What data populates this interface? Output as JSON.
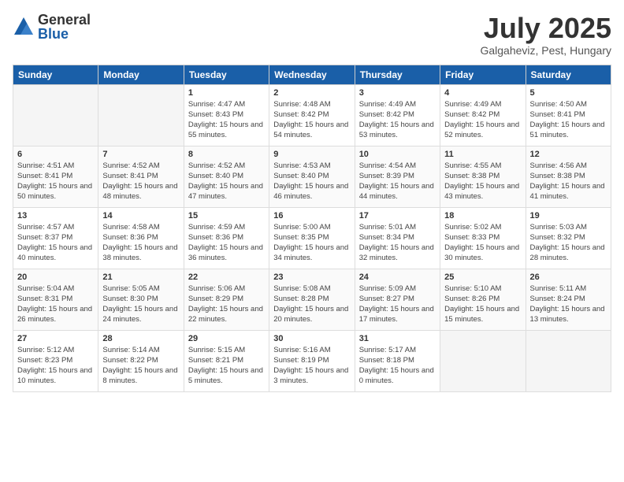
{
  "logo": {
    "general": "General",
    "blue": "Blue"
  },
  "header": {
    "month": "July 2025",
    "location": "Galgaheviz, Pest, Hungary"
  },
  "weekdays": [
    "Sunday",
    "Monday",
    "Tuesday",
    "Wednesday",
    "Thursday",
    "Friday",
    "Saturday"
  ],
  "weeks": [
    [
      {
        "day": "",
        "empty": true
      },
      {
        "day": "",
        "empty": true
      },
      {
        "day": "1",
        "sunrise": "4:47 AM",
        "sunset": "8:43 PM",
        "daylight": "15 hours and 55 minutes."
      },
      {
        "day": "2",
        "sunrise": "4:48 AM",
        "sunset": "8:42 PM",
        "daylight": "15 hours and 54 minutes."
      },
      {
        "day": "3",
        "sunrise": "4:49 AM",
        "sunset": "8:42 PM",
        "daylight": "15 hours and 53 minutes."
      },
      {
        "day": "4",
        "sunrise": "4:49 AM",
        "sunset": "8:42 PM",
        "daylight": "15 hours and 52 minutes."
      },
      {
        "day": "5",
        "sunrise": "4:50 AM",
        "sunset": "8:41 PM",
        "daylight": "15 hours and 51 minutes."
      }
    ],
    [
      {
        "day": "6",
        "sunrise": "4:51 AM",
        "sunset": "8:41 PM",
        "daylight": "15 hours and 50 minutes."
      },
      {
        "day": "7",
        "sunrise": "4:52 AM",
        "sunset": "8:41 PM",
        "daylight": "15 hours and 48 minutes."
      },
      {
        "day": "8",
        "sunrise": "4:52 AM",
        "sunset": "8:40 PM",
        "daylight": "15 hours and 47 minutes."
      },
      {
        "day": "9",
        "sunrise": "4:53 AM",
        "sunset": "8:40 PM",
        "daylight": "15 hours and 46 minutes."
      },
      {
        "day": "10",
        "sunrise": "4:54 AM",
        "sunset": "8:39 PM",
        "daylight": "15 hours and 44 minutes."
      },
      {
        "day": "11",
        "sunrise": "4:55 AM",
        "sunset": "8:38 PM",
        "daylight": "15 hours and 43 minutes."
      },
      {
        "day": "12",
        "sunrise": "4:56 AM",
        "sunset": "8:38 PM",
        "daylight": "15 hours and 41 minutes."
      }
    ],
    [
      {
        "day": "13",
        "sunrise": "4:57 AM",
        "sunset": "8:37 PM",
        "daylight": "15 hours and 40 minutes."
      },
      {
        "day": "14",
        "sunrise": "4:58 AM",
        "sunset": "8:36 PM",
        "daylight": "15 hours and 38 minutes."
      },
      {
        "day": "15",
        "sunrise": "4:59 AM",
        "sunset": "8:36 PM",
        "daylight": "15 hours and 36 minutes."
      },
      {
        "day": "16",
        "sunrise": "5:00 AM",
        "sunset": "8:35 PM",
        "daylight": "15 hours and 34 minutes."
      },
      {
        "day": "17",
        "sunrise": "5:01 AM",
        "sunset": "8:34 PM",
        "daylight": "15 hours and 32 minutes."
      },
      {
        "day": "18",
        "sunrise": "5:02 AM",
        "sunset": "8:33 PM",
        "daylight": "15 hours and 30 minutes."
      },
      {
        "day": "19",
        "sunrise": "5:03 AM",
        "sunset": "8:32 PM",
        "daylight": "15 hours and 28 minutes."
      }
    ],
    [
      {
        "day": "20",
        "sunrise": "5:04 AM",
        "sunset": "8:31 PM",
        "daylight": "15 hours and 26 minutes."
      },
      {
        "day": "21",
        "sunrise": "5:05 AM",
        "sunset": "8:30 PM",
        "daylight": "15 hours and 24 minutes."
      },
      {
        "day": "22",
        "sunrise": "5:06 AM",
        "sunset": "8:29 PM",
        "daylight": "15 hours and 22 minutes."
      },
      {
        "day": "23",
        "sunrise": "5:08 AM",
        "sunset": "8:28 PM",
        "daylight": "15 hours and 20 minutes."
      },
      {
        "day": "24",
        "sunrise": "5:09 AM",
        "sunset": "8:27 PM",
        "daylight": "15 hours and 17 minutes."
      },
      {
        "day": "25",
        "sunrise": "5:10 AM",
        "sunset": "8:26 PM",
        "daylight": "15 hours and 15 minutes."
      },
      {
        "day": "26",
        "sunrise": "5:11 AM",
        "sunset": "8:24 PM",
        "daylight": "15 hours and 13 minutes."
      }
    ],
    [
      {
        "day": "27",
        "sunrise": "5:12 AM",
        "sunset": "8:23 PM",
        "daylight": "15 hours and 10 minutes."
      },
      {
        "day": "28",
        "sunrise": "5:14 AM",
        "sunset": "8:22 PM",
        "daylight": "15 hours and 8 minutes."
      },
      {
        "day": "29",
        "sunrise": "5:15 AM",
        "sunset": "8:21 PM",
        "daylight": "15 hours and 5 minutes."
      },
      {
        "day": "30",
        "sunrise": "5:16 AM",
        "sunset": "8:19 PM",
        "daylight": "15 hours and 3 minutes."
      },
      {
        "day": "31",
        "sunrise": "5:17 AM",
        "sunset": "8:18 PM",
        "daylight": "15 hours and 0 minutes."
      },
      {
        "day": "",
        "empty": true
      },
      {
        "day": "",
        "empty": true
      }
    ]
  ]
}
